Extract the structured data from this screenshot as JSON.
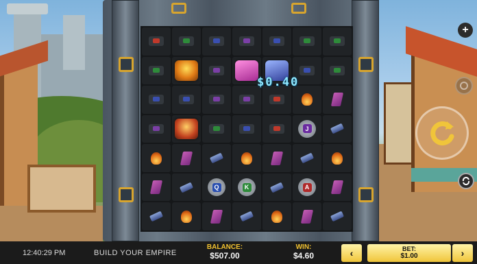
{
  "game": {
    "title": "BUILD YOUR EMPIRE",
    "time": "12:40:29 PM"
  },
  "status": {
    "balance_label": "BALANCE:",
    "balance_value": "$507.00",
    "win_label": "WIN:",
    "win_value": "$4.60"
  },
  "bet": {
    "label": "BET:",
    "value": "$1.00",
    "decrease": "‹",
    "increase": "›"
  },
  "reel": {
    "win_popup": "$0.40",
    "grid": [
      [
        "base-red",
        "base-green",
        "base-blue",
        "base-purple",
        "base-blue",
        "base-green",
        "base-green"
      ],
      [
        "base-green",
        "big-fire",
        "base-purple",
        "big-pink",
        "big-crystal",
        "base-blue",
        "base-green"
      ],
      [
        "base-blue",
        "base-blue",
        "base-purple",
        "base-purple",
        "base-red",
        "flame",
        "gem"
      ],
      [
        "base-purple",
        "big-red",
        "base-green",
        "base-blue",
        "base-red",
        "letter-J",
        "bar"
      ],
      [
        "flame",
        "gem",
        "bar",
        "flame",
        "gem",
        "bar",
        "flame"
      ],
      [
        "gem",
        "bar",
        "letter-Q",
        "letter-K",
        "bar",
        "letter-A",
        "gem"
      ],
      [
        "bar",
        "flame",
        "gem",
        "bar",
        "flame",
        "gem",
        "bar"
      ]
    ]
  },
  "controls": {
    "plus_icon": "+",
    "spin_icon": "spin-icon",
    "autoplay_icon": "autoplay-icon"
  },
  "colors": {
    "accent": "#f0c53a",
    "win_text": "#8fe8ff"
  }
}
